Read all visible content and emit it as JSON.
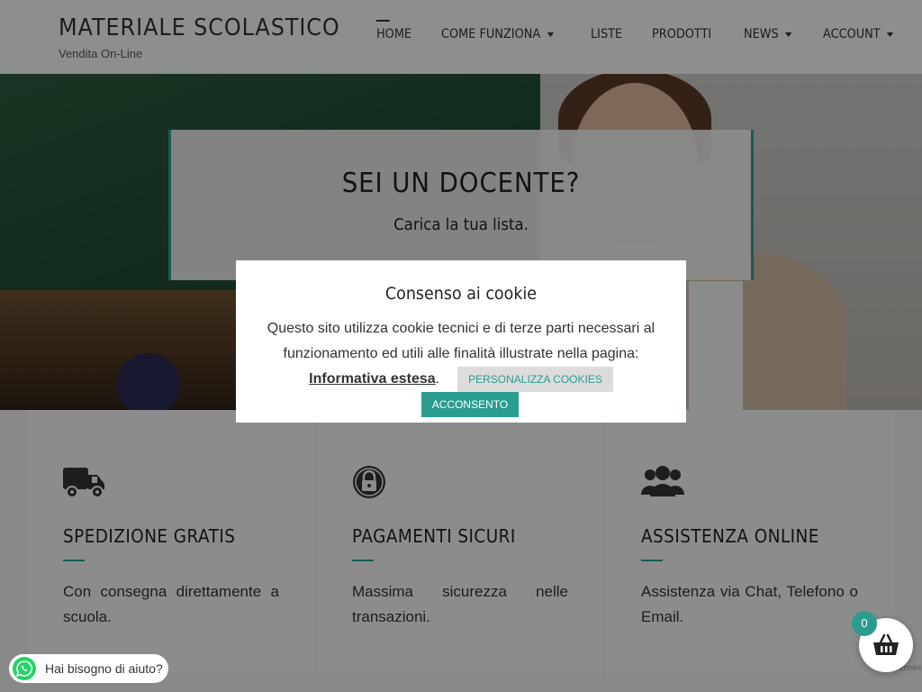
{
  "header": {
    "site_title": "MATERIALE SCOLASTICO",
    "tagline": "Vendita On-Line",
    "nav": [
      {
        "label": "HOME",
        "dropdown": false
      },
      {
        "label": "COME FUNZIONA",
        "dropdown": true
      },
      {
        "label": "LISTE",
        "dropdown": false
      },
      {
        "label": "PRODOTTI",
        "dropdown": false
      },
      {
        "label": "NEWS",
        "dropdown": true
      },
      {
        "label": "ACCOUNT",
        "dropdown": true
      }
    ]
  },
  "hero": {
    "title": "SEI UN DOCENTE?",
    "subtitle": "Carica la tua lista."
  },
  "features": [
    {
      "icon": "truck-icon",
      "title": "SPEDIZIONE GRATIS",
      "text": "Con consegna direttamente a scuola."
    },
    {
      "icon": "lock-icon",
      "title": "PAGAMENTI SICURI",
      "text": "Massima sicurezza nelle transazioni."
    },
    {
      "icon": "users-icon",
      "title": "ASSISTENZA ONLINE",
      "text": "Assistenza via Chat, Telefono o Email."
    }
  ],
  "cookie_modal": {
    "title": "Consenso ai cookie",
    "text": "Questo sito utilizza cookie tecnici e di terze parti necessari al funzionamento ed utili alle finalità illustrate nella pagina: ",
    "link_text": "Informativa estesa",
    "trailing": ".",
    "customize_label": "PERSONALIZZA COOKIES",
    "accept_label": "ACCONSENTO"
  },
  "whatsapp": {
    "label": "Hai bisogno di aiuto?"
  },
  "cart": {
    "count": "0"
  },
  "recaptcha": {
    "label": "Termini"
  },
  "colors": {
    "accent": "#2a9d8f",
    "whatsapp": "#25d366"
  }
}
